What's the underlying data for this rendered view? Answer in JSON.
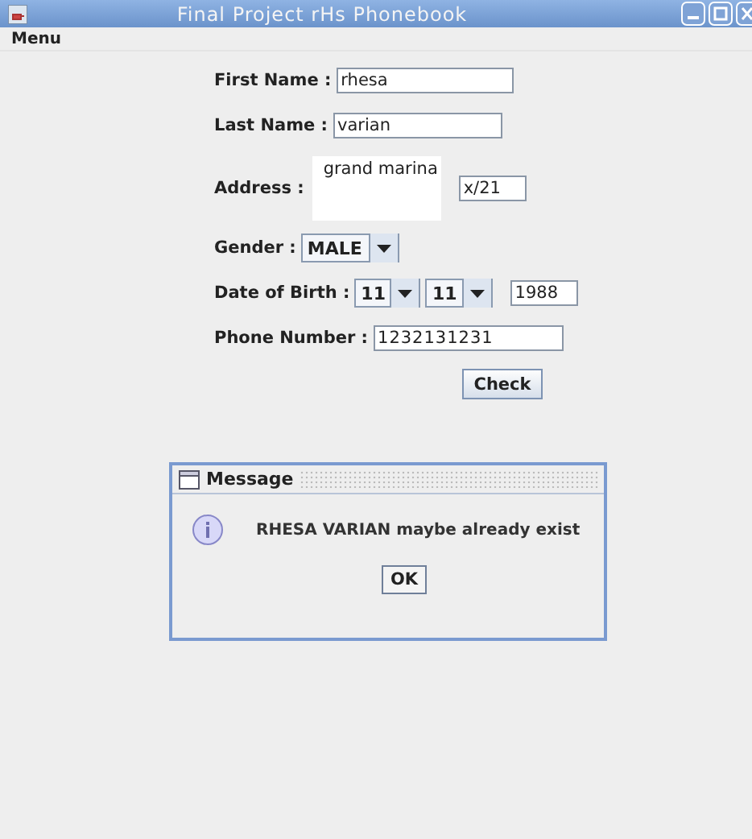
{
  "window": {
    "title": "Final Project rHs Phonebook"
  },
  "menu": [
    "Menu"
  ],
  "form": {
    "first_name": {
      "label": "First Name :",
      "value": "rhesa"
    },
    "last_name": {
      "label": "Last Name :",
      "value": "varian"
    },
    "address": {
      "label": "Address :",
      "value": "grand marina",
      "number": "x/21"
    },
    "gender": {
      "label": "Gender :",
      "value": "MALE"
    },
    "birth": {
      "label": "Date of Birth :",
      "day": "11",
      "month": "11",
      "year": "1988"
    },
    "phone": {
      "label": "Phone Number :",
      "value": "1232131231"
    },
    "button": "Check"
  },
  "dialog": {
    "title": "Message",
    "message": "RHESA VARIAN maybe already exist",
    "button": "OK"
  }
}
